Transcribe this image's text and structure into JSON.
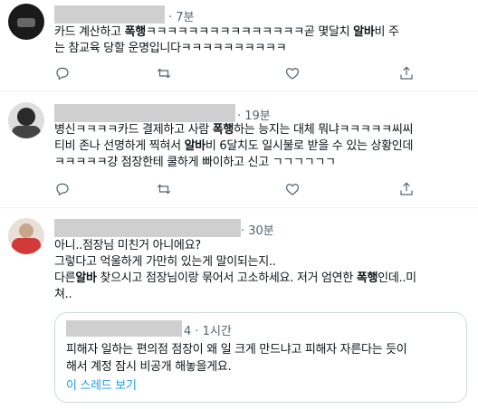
{
  "tweets": [
    {
      "time": "7분",
      "lines": [
        [
          "카드 계산하고 ",
          {
            "b": "폭행"
          },
          "ㅋㅋㅋㅋㅋㅋㅋㅋㅋㅋㅋㅋㅋㅋㅋ곧 몇달치 ",
          {
            "b": "알바"
          },
          "비 주"
        ],
        [
          "는 참교육 당할 운명입니다ㅋㅋㅋㅋㅋㅋㅋㅋㅋㅋ"
        ]
      ]
    },
    {
      "time": "19분",
      "lines": [
        [
          "병신ㅋㅋㅋㅋ카드 결제하고 사람 ",
          {
            "b": "폭행"
          },
          "하는 능지는 대체 뭐냐ㅋㅋㅋㅋㅋ씨씨"
        ],
        [
          "티비 존나 선명하게 찍혀서 ",
          {
            "b": "알바"
          },
          "비 6달치도 일시불로 받을 수 있는 상황인데"
        ],
        [
          "ㅋㅋㅋㅋㅋ걍 점장한테 쿨하게 빠이하고 신고 ㄱㄱㄱㄱㄱㄱ"
        ]
      ]
    },
    {
      "time": "30분",
      "lines": [
        [
          "아니..점장님 미친거 아니에요?"
        ],
        [
          "그렇다고 억울하게 가만히 있는게 말이되는지.."
        ],
        [
          "다른",
          {
            "b": "알바"
          },
          " 찾으시고 점장님이랑 묶어서 고소하세요. 저거 엄연한 ",
          {
            "b": "폭행"
          },
          "인데..미"
        ],
        [
          "쳐.."
        ]
      ],
      "quote": {
        "time": "1시간",
        "lines": [
          "피해자 일하는 편의점 점장이 왜 일 크게 만드냐고 피해자 자른다는 듯이",
          "해서 계정 잠시 비공개 해놓을게요."
        ],
        "link": "이 스레드 보기"
      }
    }
  ],
  "icons": [
    "reply-icon",
    "retweet-icon",
    "like-icon",
    "share-icon"
  ]
}
